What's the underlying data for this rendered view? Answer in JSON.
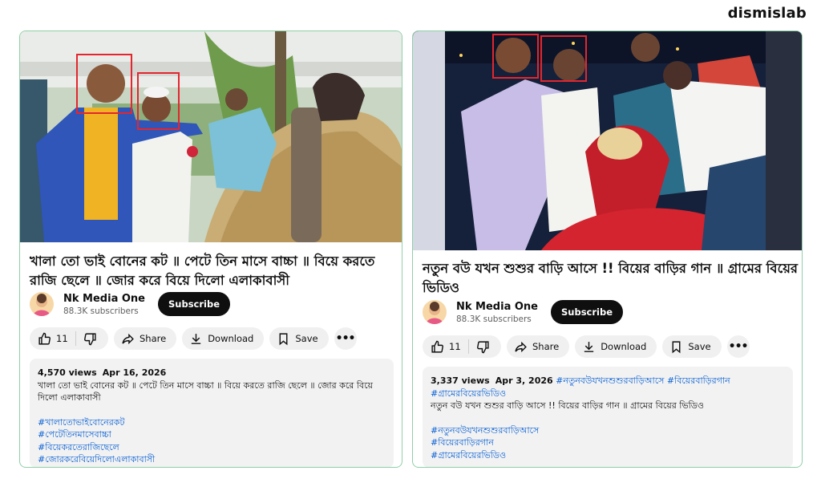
{
  "brand": "dismislab",
  "cards": [
    {
      "title": "খালা তো ভাই বোনের কট ॥ পেটে তিন মাসে বাচ্চা ॥ বিয়ে করতে রাজি ছেলে ॥ জোর করে বিয়ে দিলো এলাকাবাসী",
      "channel": {
        "name": "Nk Media One",
        "subscribers": "88.3K subscribers",
        "subscribe": "Subscribe"
      },
      "actions": {
        "likes": "11",
        "share": "Share",
        "download": "Download",
        "save": "Save"
      },
      "description": {
        "views": "4,570 views",
        "date": "Apr 16, 2026",
        "text": "খালা তো ভাই বোনের কট ॥ পেটে তিন মাসে বাচ্চা ॥ বিয়ে করতে রাজি ছেলে ॥ জোর করে বিয়ে দিলো এলাকাবাসী",
        "hashtags": [
          "#খালাতোভাইবোনেরকট",
          "#পেটেতিনমাসেবাচ্চা",
          "#বিয়েকরতেরাজিছেলে",
          "#জোরকরেবিয়েদিলোএলাকাবাসী"
        ]
      }
    },
    {
      "title": "নতুন বউ যখন শুশুর বাড়ি আসে !! বিয়ের বাড়ির গান ॥ গ্রামের বিয়ের ভিডিও",
      "channel": {
        "name": "Nk Media One",
        "subscribers": "88.3K subscribers",
        "subscribe": "Subscribe"
      },
      "actions": {
        "likes": "11",
        "share": "Share",
        "download": "Download",
        "save": "Save"
      },
      "description": {
        "views": "3,337 views",
        "date": "Apr 3, 2026",
        "inline_hashtags": "#নতুনবউযখনশুশুরবাড়িআসে #বিয়েরবাড়িরগান",
        "first_hashtag": "#গ্রামেরবিয়েরভিডিও",
        "text": "নতুন বউ যখন শুশুর বাড়ি আসে !! বিয়ের বাড়ির গান ॥ গ্রামের বিয়ের ভিডিও",
        "hashtags": [
          "#নতুনবউযখনশুশুরবাড়িআসে",
          "#বিয়েরবাড়িরগান",
          "#গ্রামেরবিয়েরভিডিও"
        ]
      }
    }
  ],
  "colors": {
    "card_border": "#8fd0a8",
    "highlight": "#e3262f",
    "hashtag": "#065fd4"
  }
}
